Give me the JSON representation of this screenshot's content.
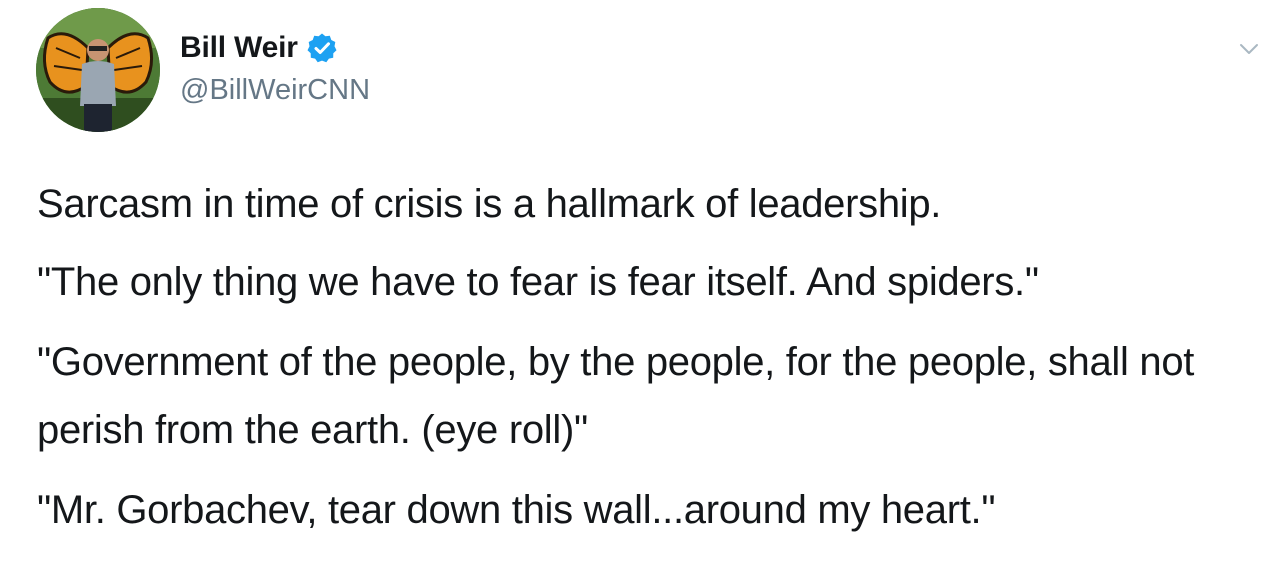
{
  "tweet": {
    "author": {
      "display_name": "Bill Weir",
      "handle": "@BillWeirCNN",
      "verified": true
    },
    "paragraphs": [
      "Sarcasm in time of crisis is a hallmark of leadership.",
      "\"The only thing we have to fear is fear itself. And spiders.\"",
      "\"Government of the people, by the people, for the people, shall not perish from the earth. (eye roll)\"",
      "\"Mr. Gorbachev, tear down this wall...around my heart.\""
    ]
  },
  "colors": {
    "text": "#14171a",
    "secondary": "#657786",
    "verified_badge": "#1da1f2",
    "background": "#ffffff"
  },
  "icons": {
    "verified": "verified-badge-icon",
    "menu": "chevron-down-icon"
  }
}
